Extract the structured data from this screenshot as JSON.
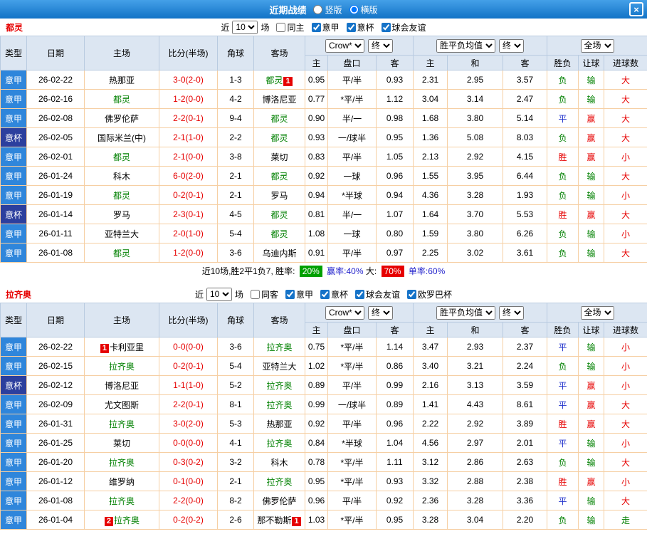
{
  "titlebar": {
    "title": "近期战绩",
    "layout_options": [
      {
        "label": "竖版",
        "selected": false
      },
      {
        "label": "横版",
        "selected": true
      }
    ],
    "close_label": "×"
  },
  "colors": {
    "league_serie_a": "#2f86db",
    "league_cup": "#2c3f9e",
    "focus_team_green": "#008000",
    "score_red": "#e60000",
    "result_red": "#e60000",
    "result_green": "#008000",
    "result_blue": "#2233cc",
    "summary_win_badge": "#00a000",
    "summary_over_badge": "#e60000"
  },
  "table_header": {
    "type": "类型",
    "date": "日期",
    "home": "主场",
    "score": "比分(半场)",
    "corner": "角球",
    "away": "客场",
    "asian_company": "Crow*",
    "asian_final": "终",
    "euro_company": "胜平负均值",
    "euro_final": "终",
    "scope": "全场",
    "sub_columns": [
      "主",
      "盘口",
      "客",
      "主",
      "和",
      "客",
      "胜负",
      "让球",
      "进球数"
    ]
  },
  "sections": [
    {
      "team": "都灵",
      "filters": {
        "near": "近",
        "count": "10",
        "games": "场",
        "checkboxes": [
          {
            "label": "同主",
            "checked": false
          },
          {
            "label": "意甲",
            "checked": true
          },
          {
            "label": "意杯",
            "checked": true
          },
          {
            "label": "球会友谊",
            "checked": true
          }
        ]
      },
      "rows": [
        {
          "league": "意甲",
          "cup": false,
          "date": "26-02-22",
          "home": {
            "name": "热那亚"
          },
          "score": "3-0(2-0)",
          "corner": "1-3",
          "away": {
            "name": "都灵",
            "focus": true,
            "badge_after": "1"
          },
          "asian": [
            "0.95",
            "平/半",
            "0.93"
          ],
          "euro": [
            "2.31",
            "2.95",
            "3.57"
          ],
          "results": [
            {
              "t": "负",
              "c": "g"
            },
            {
              "t": "输",
              "c": "g"
            },
            {
              "t": "大",
              "c": "r"
            }
          ]
        },
        {
          "league": "意甲",
          "cup": false,
          "date": "26-02-16",
          "home": {
            "name": "都灵",
            "focus": true
          },
          "score": "1-2(0-0)",
          "corner": "4-2",
          "away": {
            "name": "博洛尼亚"
          },
          "asian": [
            "0.77",
            "*平/半",
            "1.12"
          ],
          "euro": [
            "3.04",
            "3.14",
            "2.47"
          ],
          "results": [
            {
              "t": "负",
              "c": "g"
            },
            {
              "t": "输",
              "c": "g"
            },
            {
              "t": "大",
              "c": "r"
            }
          ]
        },
        {
          "league": "意甲",
          "cup": false,
          "date": "26-02-08",
          "home": {
            "name": "佛罗伦萨"
          },
          "score": "2-2(0-1)",
          "corner": "9-4",
          "away": {
            "name": "都灵",
            "focus": true
          },
          "asian": [
            "0.90",
            "半/一",
            "0.98"
          ],
          "euro": [
            "1.68",
            "3.80",
            "5.14"
          ],
          "results": [
            {
              "t": "平",
              "c": "b"
            },
            {
              "t": "赢",
              "c": "r"
            },
            {
              "t": "大",
              "c": "r"
            }
          ]
        },
        {
          "league": "意杯",
          "cup": true,
          "date": "26-02-05",
          "home": {
            "name": "国际米兰(中)"
          },
          "score": "2-1(1-0)",
          "corner": "2-2",
          "away": {
            "name": "都灵",
            "focus": true
          },
          "asian": [
            "0.93",
            "一/球半",
            "0.95"
          ],
          "euro": [
            "1.36",
            "5.08",
            "8.03"
          ],
          "results": [
            {
              "t": "负",
              "c": "g"
            },
            {
              "t": "赢",
              "c": "r"
            },
            {
              "t": "大",
              "c": "r"
            }
          ]
        },
        {
          "league": "意甲",
          "cup": false,
          "date": "26-02-01",
          "home": {
            "name": "都灵",
            "focus": true
          },
          "score": "2-1(0-0)",
          "corner": "3-8",
          "away": {
            "name": "莱切"
          },
          "asian": [
            "0.83",
            "平/半",
            "1.05"
          ],
          "euro": [
            "2.13",
            "2.92",
            "4.15"
          ],
          "results": [
            {
              "t": "胜",
              "c": "r"
            },
            {
              "t": "赢",
              "c": "r"
            },
            {
              "t": "小",
              "c": "r"
            }
          ]
        },
        {
          "league": "意甲",
          "cup": false,
          "date": "26-01-24",
          "home": {
            "name": "科木"
          },
          "score": "6-0(2-0)",
          "corner": "2-1",
          "away": {
            "name": "都灵",
            "focus": true
          },
          "asian": [
            "0.92",
            "一球",
            "0.96"
          ],
          "euro": [
            "1.55",
            "3.95",
            "6.44"
          ],
          "results": [
            {
              "t": "负",
              "c": "g"
            },
            {
              "t": "输",
              "c": "g"
            },
            {
              "t": "大",
              "c": "r"
            }
          ]
        },
        {
          "league": "意甲",
          "cup": false,
          "date": "26-01-19",
          "home": {
            "name": "都灵",
            "focus": true
          },
          "score": "0-2(0-1)",
          "corner": "2-1",
          "away": {
            "name": "罗马"
          },
          "asian": [
            "0.94",
            "*半球",
            "0.94"
          ],
          "euro": [
            "4.36",
            "3.28",
            "1.93"
          ],
          "results": [
            {
              "t": "负",
              "c": "g"
            },
            {
              "t": "输",
              "c": "g"
            },
            {
              "t": "小",
              "c": "r"
            }
          ]
        },
        {
          "league": "意杯",
          "cup": true,
          "date": "26-01-14",
          "home": {
            "name": "罗马"
          },
          "score": "2-3(0-1)",
          "corner": "4-5",
          "away": {
            "name": "都灵",
            "focus": true
          },
          "asian": [
            "0.81",
            "半/一",
            "1.07"
          ],
          "euro": [
            "1.64",
            "3.70",
            "5.53"
          ],
          "results": [
            {
              "t": "胜",
              "c": "r"
            },
            {
              "t": "赢",
              "c": "r"
            },
            {
              "t": "大",
              "c": "r"
            }
          ]
        },
        {
          "league": "意甲",
          "cup": false,
          "date": "26-01-11",
          "home": {
            "name": "亚特兰大"
          },
          "score": "2-0(1-0)",
          "corner": "5-4",
          "away": {
            "name": "都灵",
            "focus": true
          },
          "asian": [
            "1.08",
            "一球",
            "0.80"
          ],
          "euro": [
            "1.59",
            "3.80",
            "6.26"
          ],
          "results": [
            {
              "t": "负",
              "c": "g"
            },
            {
              "t": "输",
              "c": "g"
            },
            {
              "t": "小",
              "c": "r"
            }
          ]
        },
        {
          "league": "意甲",
          "cup": false,
          "date": "26-01-08",
          "home": {
            "name": "都灵",
            "focus": true
          },
          "score": "1-2(0-0)",
          "corner": "3-6",
          "away": {
            "name": "乌迪内斯"
          },
          "asian": [
            "0.91",
            "平/半",
            "0.97"
          ],
          "euro": [
            "2.25",
            "3.02",
            "3.61"
          ],
          "results": [
            {
              "t": "负",
              "c": "g"
            },
            {
              "t": "输",
              "c": "g"
            },
            {
              "t": "大",
              "c": "r"
            }
          ]
        }
      ],
      "summary": [
        {
          "text": "近10场,胜2平1负7, 胜率: ",
          "style": "plain"
        },
        {
          "text": "20%",
          "style": "badge-green"
        },
        {
          "text": " 赢率:40% ",
          "style": "blue"
        },
        {
          "text": "大: ",
          "style": "plain"
        },
        {
          "text": "70%",
          "style": "badge-red"
        },
        {
          "text": " 单率:60%",
          "style": "blue"
        }
      ]
    },
    {
      "team": "拉齐奥",
      "filters": {
        "near": "近",
        "count": "10",
        "games": "场",
        "checkboxes": [
          {
            "label": "同客",
            "checked": false
          },
          {
            "label": "意甲",
            "checked": true
          },
          {
            "label": "意杯",
            "checked": true
          },
          {
            "label": "球会友谊",
            "checked": true
          },
          {
            "label": "欧罗巴杯",
            "checked": true
          }
        ]
      },
      "rows": [
        {
          "league": "意甲",
          "cup": false,
          "date": "26-02-22",
          "home": {
            "name": "卡利亚里",
            "badge_before": "1"
          },
          "score": "0-0(0-0)",
          "corner": "3-6",
          "away": {
            "name": "拉齐奥",
            "focus": true
          },
          "asian": [
            "0.75",
            "*平/半",
            "1.14"
          ],
          "euro": [
            "3.47",
            "2.93",
            "2.37"
          ],
          "results": [
            {
              "t": "平",
              "c": "b"
            },
            {
              "t": "输",
              "c": "g"
            },
            {
              "t": "小",
              "c": "r"
            }
          ]
        },
        {
          "league": "意甲",
          "cup": false,
          "date": "26-02-15",
          "home": {
            "name": "拉齐奥",
            "focus": true
          },
          "score": "0-2(0-1)",
          "corner": "5-4",
          "away": {
            "name": "亚特兰大"
          },
          "asian": [
            "1.02",
            "*平/半",
            "0.86"
          ],
          "euro": [
            "3.40",
            "3.21",
            "2.24"
          ],
          "results": [
            {
              "t": "负",
              "c": "g"
            },
            {
              "t": "输",
              "c": "g"
            },
            {
              "t": "小",
              "c": "r"
            }
          ]
        },
        {
          "league": "意杯",
          "cup": true,
          "date": "26-02-12",
          "home": {
            "name": "博洛尼亚"
          },
          "score": "1-1(1-0)",
          "corner": "5-2",
          "away": {
            "name": "拉齐奥",
            "focus": true
          },
          "asian": [
            "0.89",
            "平/半",
            "0.99"
          ],
          "euro": [
            "2.16",
            "3.13",
            "3.59"
          ],
          "results": [
            {
              "t": "平",
              "c": "b"
            },
            {
              "t": "赢",
              "c": "r"
            },
            {
              "t": "小",
              "c": "r"
            }
          ]
        },
        {
          "league": "意甲",
          "cup": false,
          "date": "26-02-09",
          "home": {
            "name": "尤文图斯"
          },
          "score": "2-2(0-1)",
          "corner": "8-1",
          "away": {
            "name": "拉齐奥",
            "focus": true
          },
          "asian": [
            "0.99",
            "一/球半",
            "0.89"
          ],
          "euro": [
            "1.41",
            "4.43",
            "8.61"
          ],
          "results": [
            {
              "t": "平",
              "c": "b"
            },
            {
              "t": "赢",
              "c": "r"
            },
            {
              "t": "大",
              "c": "r"
            }
          ]
        },
        {
          "league": "意甲",
          "cup": false,
          "date": "26-01-31",
          "home": {
            "name": "拉齐奥",
            "focus": true
          },
          "score": "3-0(2-0)",
          "corner": "5-3",
          "away": {
            "name": "热那亚"
          },
          "asian": [
            "0.92",
            "平/半",
            "0.96"
          ],
          "euro": [
            "2.22",
            "2.92",
            "3.89"
          ],
          "results": [
            {
              "t": "胜",
              "c": "r"
            },
            {
              "t": "赢",
              "c": "r"
            },
            {
              "t": "大",
              "c": "r"
            }
          ]
        },
        {
          "league": "意甲",
          "cup": false,
          "date": "26-01-25",
          "home": {
            "name": "莱切"
          },
          "score": "0-0(0-0)",
          "corner": "4-1",
          "away": {
            "name": "拉齐奥",
            "focus": true
          },
          "asian": [
            "0.84",
            "*半球",
            "1.04"
          ],
          "euro": [
            "4.56",
            "2.97",
            "2.01"
          ],
          "results": [
            {
              "t": "平",
              "c": "b"
            },
            {
              "t": "输",
              "c": "g"
            },
            {
              "t": "小",
              "c": "r"
            }
          ]
        },
        {
          "league": "意甲",
          "cup": false,
          "date": "26-01-20",
          "home": {
            "name": "拉齐奥",
            "focus": true
          },
          "score": "0-3(0-2)",
          "corner": "3-2",
          "away": {
            "name": "科木"
          },
          "asian": [
            "0.78",
            "*平/半",
            "1.11"
          ],
          "euro": [
            "3.12",
            "2.86",
            "2.63"
          ],
          "results": [
            {
              "t": "负",
              "c": "g"
            },
            {
              "t": "输",
              "c": "g"
            },
            {
              "t": "大",
              "c": "r"
            }
          ]
        },
        {
          "league": "意甲",
          "cup": false,
          "date": "26-01-12",
          "home": {
            "name": "维罗纳"
          },
          "score": "0-1(0-0)",
          "corner": "2-1",
          "away": {
            "name": "拉齐奥",
            "focus": true
          },
          "asian": [
            "0.95",
            "*平/半",
            "0.93"
          ],
          "euro": [
            "3.32",
            "2.88",
            "2.38"
          ],
          "results": [
            {
              "t": "胜",
              "c": "r"
            },
            {
              "t": "赢",
              "c": "r"
            },
            {
              "t": "小",
              "c": "r"
            }
          ]
        },
        {
          "league": "意甲",
          "cup": false,
          "date": "26-01-08",
          "home": {
            "name": "拉齐奥",
            "focus": true
          },
          "score": "2-2(0-0)",
          "corner": "8-2",
          "away": {
            "name": "佛罗伦萨"
          },
          "asian": [
            "0.96",
            "平/半",
            "0.92"
          ],
          "euro": [
            "2.36",
            "3.28",
            "3.36"
          ],
          "results": [
            {
              "t": "平",
              "c": "b"
            },
            {
              "t": "输",
              "c": "g"
            },
            {
              "t": "大",
              "c": "r"
            }
          ]
        },
        {
          "league": "意甲",
          "cup": false,
          "date": "26-01-04",
          "home": {
            "name": "拉齐奥",
            "focus": true,
            "badge_before": "2"
          },
          "score": "0-2(0-2)",
          "corner": "2-6",
          "away": {
            "name": "那不勒斯",
            "badge_after": "1"
          },
          "asian": [
            "1.03",
            "*平/半",
            "0.95"
          ],
          "euro": [
            "3.28",
            "3.04",
            "2.20"
          ],
          "results": [
            {
              "t": "负",
              "c": "g"
            },
            {
              "t": "输",
              "c": "g"
            },
            {
              "t": "走",
              "c": "g"
            }
          ]
        }
      ],
      "summary": []
    }
  ]
}
